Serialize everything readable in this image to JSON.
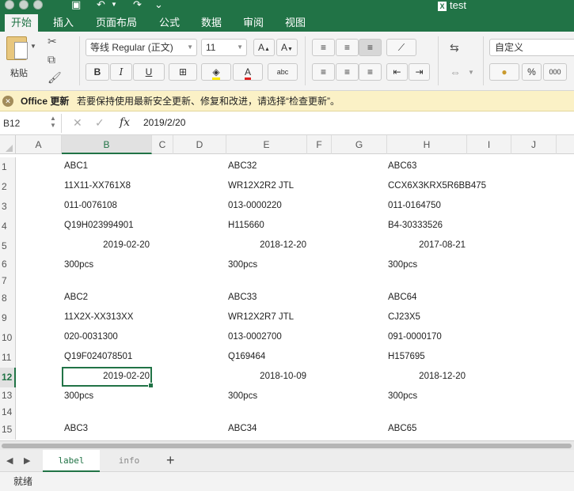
{
  "window": {
    "title": "test",
    "tabs": [
      "开始",
      "插入",
      "页面布局",
      "公式",
      "数据",
      "审阅",
      "视图"
    ],
    "active_tab": "开始"
  },
  "ribbon": {
    "paste_label": "粘贴",
    "font_name": "等线 Regular (正文)",
    "font_size": "11",
    "bold": "B",
    "italic": "I",
    "underline": "U",
    "font_grow": "A",
    "font_shrink": "A",
    "font_color": "A",
    "phonetic": "abc",
    "number_format": "自定义",
    "percent": "%",
    "thousands": "000"
  },
  "infobar": {
    "title": "Office 更新",
    "message": "若要保持使用最新安全更新、修复和改进，请选择“检查更新”。"
  },
  "formula_bar": {
    "name_box": "B12",
    "fx": "fx",
    "value": "2019/2/20"
  },
  "columns": [
    "A",
    "B",
    "C",
    "D",
    "E",
    "F",
    "G",
    "H",
    "I",
    "J"
  ],
  "selected_column": "B",
  "rows": [
    {
      "n": "1",
      "b": "ABC1",
      "e": "ABC32",
      "h": "ABC63"
    },
    {
      "n": "2",
      "b": "11X11-XX761X8",
      "e": "WR12X2R2 JTL",
      "h": "CCX6X3KRX5R6BB475"
    },
    {
      "n": "3",
      "b": "011-0076108",
      "e": "013-0000220",
      "h": "011-0164750"
    },
    {
      "n": "4",
      "b": "Q19H023994901",
      "e": "H115660",
      "h": "B4-30333526"
    },
    {
      "n": "5",
      "b": "2019-02-20",
      "e": "2018-12-20",
      "h": "2017-08-21",
      "date": true
    },
    {
      "n": "6",
      "b": "300pcs",
      "e": "300pcs",
      "h": "300pcs"
    },
    {
      "n": "7",
      "b": "",
      "e": "",
      "h": ""
    },
    {
      "n": "8",
      "b": "ABC2",
      "e": "ABC33",
      "h": "ABC64"
    },
    {
      "n": "9",
      "b": "11X2X-XX313XX",
      "e": "WR12X2R7 JTL",
      "h": "CJ23X5"
    },
    {
      "n": "10",
      "b": "020-0031300",
      "e": "013-0002700",
      "h": "091-0000170"
    },
    {
      "n": "11",
      "b": "Q19F024078501",
      "e": "Q169464",
      "h": "H157695"
    },
    {
      "n": "12",
      "b": "2019-02-20",
      "e": "2018-10-09",
      "h": "2018-12-20",
      "date": true
    },
    {
      "n": "13",
      "b": "300pcs",
      "e": "300pcs",
      "h": "300pcs"
    },
    {
      "n": "14",
      "b": "",
      "e": "",
      "h": ""
    },
    {
      "n": "15",
      "b": "ABC3",
      "e": "ABC34",
      "h": "ABC65"
    }
  ],
  "selected_row": "12",
  "sheets": {
    "tabs": [
      "label",
      "info"
    ],
    "active": "label",
    "add": "+"
  },
  "status": "就绪",
  "colors": {
    "accent": "#217346",
    "infobar_bg": "#fbf1c6"
  }
}
